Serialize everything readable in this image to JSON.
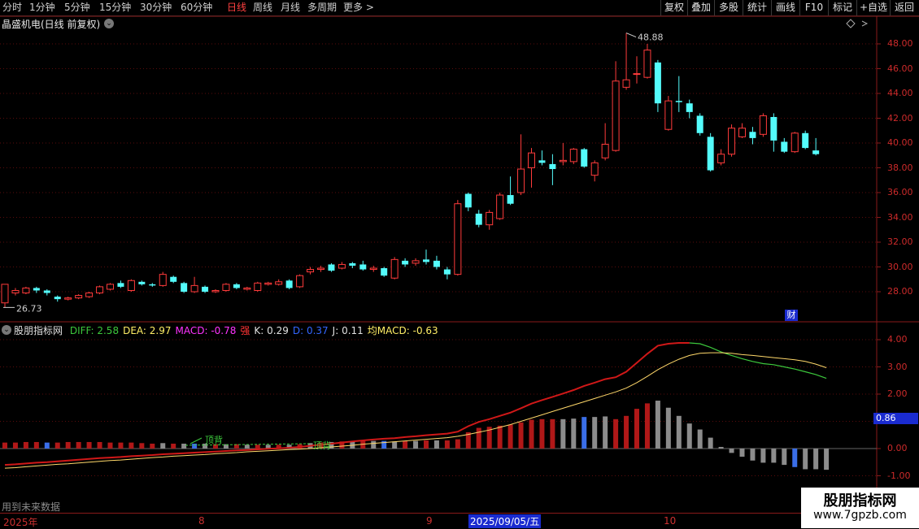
{
  "toolbar": {
    "periods": [
      "分时",
      "1分钟",
      "5分钟",
      "15分钟",
      "30分钟",
      "60分钟",
      "日线",
      "周线",
      "月线",
      "多周期",
      "更多 >"
    ],
    "active_period": "日线",
    "actions": [
      "复权",
      "叠加",
      "多股",
      "统计",
      "画线",
      "F10",
      "标记",
      "+自选",
      "返回"
    ]
  },
  "chart": {
    "title": "晶盛机电(日线 前复权)",
    "price_axis": [
      "48.00",
      "46.00",
      "44.00",
      "42.00",
      "40.00",
      "38.00",
      "36.00",
      "34.00",
      "32.00",
      "30.00",
      "28.00"
    ],
    "high_label": "48.88",
    "low_label": "26.73",
    "cai_badge": "财",
    "colors": {
      "up": "#ff3b3b",
      "down": "#54fcfc",
      "axis": "#8a1a1a",
      "grid": "#5a0c0c"
    },
    "candles": [
      {
        "o": 27.1,
        "c": 28.6,
        "h": 28.6,
        "l": 26.73
      },
      {
        "o": 27.9,
        "c": 28.1,
        "h": 28.3,
        "l": 27.7
      },
      {
        "o": 27.9,
        "c": 28.3,
        "h": 28.4,
        "l": 27.8
      },
      {
        "o": 28.3,
        "c": 28.1,
        "h": 28.4,
        "l": 27.9
      },
      {
        "o": 28.1,
        "c": 27.9,
        "h": 28.2,
        "l": 27.7
      },
      {
        "o": 27.6,
        "c": 27.4,
        "h": 27.7,
        "l": 27.2
      },
      {
        "o": 27.4,
        "c": 27.5,
        "h": 27.6,
        "l": 27.3
      },
      {
        "o": 27.5,
        "c": 27.7,
        "h": 27.8,
        "l": 27.4
      },
      {
        "o": 27.6,
        "c": 27.9,
        "h": 28.0,
        "l": 27.5
      },
      {
        "o": 27.9,
        "c": 28.4,
        "h": 28.5,
        "l": 27.8
      },
      {
        "o": 28.2,
        "c": 28.6,
        "h": 28.7,
        "l": 28.1
      },
      {
        "o": 28.7,
        "c": 28.4,
        "h": 28.9,
        "l": 28.3
      },
      {
        "o": 28.1,
        "c": 28.9,
        "h": 29.0,
        "l": 28.0
      },
      {
        "o": 28.8,
        "c": 28.6,
        "h": 28.9,
        "l": 28.5
      },
      {
        "o": 28.6,
        "c": 28.5,
        "h": 28.7,
        "l": 28.4
      },
      {
        "o": 28.5,
        "c": 29.4,
        "h": 29.6,
        "l": 28.4
      },
      {
        "o": 29.2,
        "c": 28.8,
        "h": 29.3,
        "l": 28.7
      },
      {
        "o": 28.7,
        "c": 28.0,
        "h": 28.8,
        "l": 27.9
      },
      {
        "o": 28.0,
        "c": 28.5,
        "h": 29.2,
        "l": 27.9
      },
      {
        "o": 28.4,
        "c": 28.0,
        "h": 28.5,
        "l": 27.9
      },
      {
        "o": 28.0,
        "c": 28.1,
        "h": 28.2,
        "l": 27.9
      },
      {
        "o": 28.1,
        "c": 28.6,
        "h": 28.7,
        "l": 28.0
      },
      {
        "o": 28.6,
        "c": 28.3,
        "h": 28.7,
        "l": 28.2
      },
      {
        "o": 28.2,
        "c": 28.3,
        "h": 28.4,
        "l": 28.1
      },
      {
        "o": 28.1,
        "c": 28.7,
        "h": 28.8,
        "l": 28.0
      },
      {
        "o": 28.6,
        "c": 28.7,
        "h": 28.8,
        "l": 28.5
      },
      {
        "o": 28.6,
        "c": 28.8,
        "h": 29.0,
        "l": 28.5
      },
      {
        "o": 28.9,
        "c": 28.3,
        "h": 29.0,
        "l": 28.2
      },
      {
        "o": 28.4,
        "c": 29.3,
        "h": 29.4,
        "l": 28.3
      },
      {
        "o": 29.6,
        "c": 29.8,
        "h": 30.0,
        "l": 29.4
      },
      {
        "o": 29.8,
        "c": 29.9,
        "h": 30.1,
        "l": 29.6
      },
      {
        "o": 30.2,
        "c": 29.7,
        "h": 30.3,
        "l": 29.6
      },
      {
        "o": 29.9,
        "c": 30.2,
        "h": 30.4,
        "l": 29.8
      },
      {
        "o": 30.3,
        "c": 30.1,
        "h": 30.4,
        "l": 29.9
      },
      {
        "o": 30.2,
        "c": 29.8,
        "h": 30.5,
        "l": 29.7
      },
      {
        "o": 29.8,
        "c": 29.9,
        "h": 30.1,
        "l": 29.6
      },
      {
        "o": 29.9,
        "c": 29.3,
        "h": 30.0,
        "l": 29.2
      },
      {
        "o": 29.1,
        "c": 30.6,
        "h": 30.8,
        "l": 29.0
      },
      {
        "o": 30.5,
        "c": 30.2,
        "h": 30.7,
        "l": 30.0
      },
      {
        "o": 30.3,
        "c": 30.5,
        "h": 30.7,
        "l": 30.1
      },
      {
        "o": 30.6,
        "c": 30.4,
        "h": 31.4,
        "l": 30.2
      },
      {
        "o": 30.5,
        "c": 30.0,
        "h": 30.9,
        "l": 29.8
      },
      {
        "o": 29.8,
        "c": 29.4,
        "h": 30.0,
        "l": 29.0
      },
      {
        "o": 29.4,
        "c": 35.1,
        "h": 35.4,
        "l": 29.3
      },
      {
        "o": 35.9,
        "c": 34.8,
        "h": 36.0,
        "l": 34.5
      },
      {
        "o": 34.3,
        "c": 33.4,
        "h": 34.6,
        "l": 33.2
      },
      {
        "o": 33.4,
        "c": 34.4,
        "h": 34.6,
        "l": 33.0
      },
      {
        "o": 33.9,
        "c": 35.8,
        "h": 36.0,
        "l": 33.8
      },
      {
        "o": 35.8,
        "c": 35.1,
        "h": 37.3,
        "l": 35.0
      },
      {
        "o": 36.0,
        "c": 37.9,
        "h": 40.7,
        "l": 35.8
      },
      {
        "o": 38.0,
        "c": 39.2,
        "h": 39.6,
        "l": 36.4
      },
      {
        "o": 38.6,
        "c": 38.4,
        "h": 39.4,
        "l": 38.2
      },
      {
        "o": 38.3,
        "c": 37.9,
        "h": 39.1,
        "l": 36.6
      },
      {
        "o": 38.5,
        "c": 38.6,
        "h": 40.0,
        "l": 38.2
      },
      {
        "o": 38.5,
        "c": 39.5,
        "h": 39.6,
        "l": 38.3
      },
      {
        "o": 39.5,
        "c": 38.1,
        "h": 39.6,
        "l": 38.0
      },
      {
        "o": 37.4,
        "c": 38.4,
        "h": 38.6,
        "l": 36.9
      },
      {
        "o": 38.8,
        "c": 39.9,
        "h": 41.6,
        "l": 38.6
      },
      {
        "o": 39.4,
        "c": 45.0,
        "h": 46.6,
        "l": 39.3
      },
      {
        "o": 44.5,
        "c": 45.1,
        "h": 48.88,
        "l": 44.3
      },
      {
        "o": 45.6,
        "c": 45.6,
        "h": 47.0,
        "l": 44.8
      },
      {
        "o": 45.3,
        "c": 47.5,
        "h": 48.0,
        "l": 45.2
      },
      {
        "o": 46.5,
        "c": 43.2,
        "h": 46.7,
        "l": 42.5
      },
      {
        "o": 41.1,
        "c": 43.4,
        "h": 43.8,
        "l": 41.0
      },
      {
        "o": 43.4,
        "c": 43.3,
        "h": 45.4,
        "l": 42.5
      },
      {
        "o": 43.2,
        "c": 42.5,
        "h": 43.5,
        "l": 42.0
      },
      {
        "o": 42.2,
        "c": 40.8,
        "h": 42.4,
        "l": 40.6
      },
      {
        "o": 40.5,
        "c": 37.8,
        "h": 40.8,
        "l": 37.7
      },
      {
        "o": 38.4,
        "c": 39.1,
        "h": 39.5,
        "l": 38.2
      },
      {
        "o": 39.1,
        "c": 41.2,
        "h": 41.5,
        "l": 38.9
      },
      {
        "o": 40.5,
        "c": 41.2,
        "h": 41.6,
        "l": 40.4
      },
      {
        "o": 40.9,
        "c": 40.4,
        "h": 41.3,
        "l": 39.9
      },
      {
        "o": 40.7,
        "c": 42.2,
        "h": 42.4,
        "l": 40.5
      },
      {
        "o": 42.1,
        "c": 40.2,
        "h": 42.4,
        "l": 39.3
      },
      {
        "o": 40.1,
        "c": 39.3,
        "h": 40.4,
        "l": 39.2
      },
      {
        "o": 39.3,
        "c": 40.8,
        "h": 40.9,
        "l": 39.2
      },
      {
        "o": 40.8,
        "c": 39.6,
        "h": 41.0,
        "l": 39.5
      },
      {
        "o": 39.4,
        "c": 39.1,
        "h": 40.4,
        "l": 39.0
      }
    ]
  },
  "macd": {
    "title": "股朋指标网",
    "labels": [
      {
        "text": "DIFF: 2.58",
        "color": "#3cc83c"
      },
      {
        "text": "DEA: 2.97",
        "color": "#ffee66"
      },
      {
        "text": "MACD: -0.78",
        "color": "#ff33ff"
      },
      {
        "text": "强",
        "color": "#ff3333"
      },
      {
        "text": "K: 0.29",
        "color": "#e0e0e0"
      },
      {
        "text": "D: 0.37",
        "color": "#3366ff"
      },
      {
        "text": "J: 0.11",
        "color": "#e0e0e0"
      },
      {
        "text": "均MACD: -0.63",
        "color": "#ffee66"
      }
    ],
    "axis": [
      "4.00",
      "3.00",
      "2.00",
      "1.00",
      "0.00",
      "-1.00"
    ],
    "cursor_value": "0.86",
    "divergence_labels": [
      "顶背",
      "顶背"
    ],
    "dif": [
      -0.6,
      -0.58,
      -0.55,
      -0.52,
      -0.5,
      -0.47,
      -0.44,
      -0.41,
      -0.38,
      -0.35,
      -0.33,
      -0.31,
      -0.28,
      -0.26,
      -0.24,
      -0.21,
      -0.19,
      -0.17,
      -0.15,
      -0.13,
      -0.11,
      -0.09,
      -0.07,
      -0.05,
      -0.03,
      -0.01,
      0.01,
      0.03,
      0.06,
      0.1,
      0.14,
      0.18,
      0.22,
      0.26,
      0.3,
      0.33,
      0.36,
      0.38,
      0.42,
      0.45,
      0.49,
      0.52,
      0.55,
      0.62,
      0.82,
      0.98,
      1.08,
      1.2,
      1.32,
      1.48,
      1.65,
      1.78,
      1.9,
      2.02,
      2.15,
      2.3,
      2.42,
      2.55,
      2.62,
      2.82,
      3.15,
      3.48,
      3.78,
      3.85,
      3.88,
      3.88,
      3.85,
      3.72,
      3.55,
      3.42,
      3.3,
      3.2,
      3.12,
      3.08,
      3.0,
      2.92,
      2.82,
      2.72,
      2.58
    ],
    "dea": [
      -0.72,
      -0.7,
      -0.67,
      -0.64,
      -0.61,
      -0.58,
      -0.56,
      -0.53,
      -0.5,
      -0.47,
      -0.44,
      -0.42,
      -0.39,
      -0.36,
      -0.33,
      -0.31,
      -0.28,
      -0.26,
      -0.24,
      -0.22,
      -0.19,
      -0.17,
      -0.15,
      -0.12,
      -0.1,
      -0.08,
      -0.06,
      -0.04,
      -0.02,
      0.0,
      0.03,
      0.06,
      0.09,
      0.12,
      0.16,
      0.19,
      0.22,
      0.25,
      0.28,
      0.31,
      0.34,
      0.37,
      0.4,
      0.45,
      0.52,
      0.6,
      0.68,
      0.78,
      0.88,
      1.0,
      1.12,
      1.24,
      1.36,
      1.48,
      1.6,
      1.72,
      1.84,
      1.96,
      2.08,
      2.22,
      2.42,
      2.65,
      2.9,
      3.1,
      3.28,
      3.42,
      3.5,
      3.52,
      3.52,
      3.5,
      3.45,
      3.42,
      3.38,
      3.34,
      3.3,
      3.26,
      3.2,
      3.1,
      2.97
    ],
    "macd_bars": [
      0.22,
      0.22,
      0.24,
      0.24,
      0.22,
      0.22,
      0.24,
      0.24,
      0.24,
      0.24,
      0.22,
      0.22,
      0.22,
      0.2,
      0.18,
      0.2,
      0.18,
      0.18,
      0.18,
      0.18,
      0.16,
      0.16,
      0.16,
      0.14,
      0.14,
      0.14,
      0.14,
      0.14,
      0.16,
      0.2,
      0.22,
      0.24,
      0.26,
      0.28,
      0.28,
      0.28,
      0.28,
      0.26,
      0.28,
      0.28,
      0.3,
      0.3,
      0.3,
      0.34,
      0.6,
      0.76,
      0.8,
      0.84,
      0.88,
      0.96,
      1.06,
      1.08,
      1.08,
      1.08,
      1.1,
      1.16,
      1.16,
      1.18,
      1.08,
      1.2,
      1.46,
      1.66,
      1.76,
      1.5,
      1.2,
      0.92,
      0.7,
      0.4,
      0.06,
      -0.16,
      -0.3,
      -0.44,
      -0.52,
      -0.52,
      -0.6,
      -0.68,
      -0.76,
      -0.76,
      -0.78
    ],
    "bar_colors": {
      "up": "#b01818",
      "down": "#8c8c8c",
      "blue": "#3a6ee8",
      "blue_indices": [
        4,
        18,
        36,
        55
      ]
    }
  },
  "date_axis": {
    "labels": [
      "2025年",
      "8",
      "9",
      "10"
    ],
    "cursor_date": "2025/09/05/五"
  },
  "bottom_note": "用到未来数据",
  "watermark": {
    "line1": "股朋指标网",
    "line2": "www.7gpzb.com"
  }
}
